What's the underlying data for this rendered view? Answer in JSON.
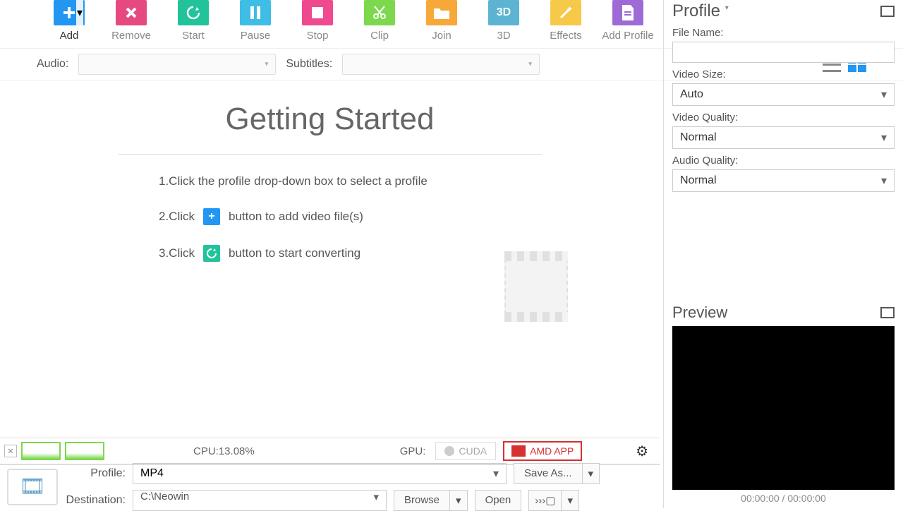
{
  "toolbar": {
    "add": "Add",
    "remove": "Remove",
    "start": "Start",
    "pause": "Pause",
    "stop": "Stop",
    "clip": "Clip",
    "join": "Join",
    "threeD": "3D",
    "effects": "Effects",
    "addProfile": "Add Profile"
  },
  "options": {
    "audioLabel": "Audio:",
    "subtitlesLabel": "Subtitles:"
  },
  "gettingStarted": {
    "title": "Getting Started",
    "step1": "1.Click the profile drop-down box to select a profile",
    "step2a": "2.Click",
    "step2b": "button to add video file(s)",
    "step3a": "3.Click",
    "step3b": "button to start converting"
  },
  "status": {
    "cpu": "CPU:13.08%",
    "gpuLabel": "GPU:",
    "cuda": "CUDA",
    "amd": "AMD APP"
  },
  "bottom": {
    "profileLabel": "Profile:",
    "profileValue": "MP4",
    "saveAs": "Save As...",
    "destLabel": "Destination:",
    "destValue": "C:\\Neowin",
    "browse": "Browse",
    "open": "Open"
  },
  "profilePanel": {
    "title": "Profile",
    "fileName": "File Name:",
    "videoSize": "Video Size:",
    "videoSizeValue": "Auto",
    "videoQuality": "Video Quality:",
    "videoQualityValue": "Normal",
    "audioQuality": "Audio Quality:",
    "audioQualityValue": "Normal"
  },
  "preview": {
    "title": "Preview",
    "time": "00:00:00 / 00:00:00"
  }
}
